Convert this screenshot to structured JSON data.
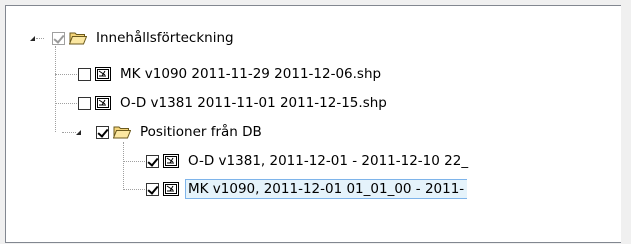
{
  "tree": {
    "root": {
      "label": "Innehållsförteckning",
      "checked": true,
      "enabled": false,
      "expanded": true,
      "icon": "folder-open-icon"
    },
    "root_items": [
      {
        "label": "MK v1090 2011-11-29 2011-12-06.shp",
        "checked": false,
        "icon": "shape-layer-icon"
      },
      {
        "label": "O-D v1381 2011-11-01 2011-12-15.shp",
        "checked": false,
        "icon": "shape-layer-icon"
      }
    ],
    "group": {
      "label": "Positioner från DB",
      "checked": true,
      "expanded": true,
      "icon": "folder-open-icon",
      "items": [
        {
          "label": "O-D v1381, 2011-12-01 - 2011-12-10 22_",
          "checked": true,
          "selected": false,
          "icon": "shape-layer-icon"
        },
        {
          "label": "MK v1090, 2011-12-01 01_01_00 - 2011-",
          "checked": true,
          "selected": true,
          "icon": "shape-layer-icon"
        }
      ]
    }
  },
  "colors": {
    "selection_fill": "#e5f3fb",
    "selection_border": "#7eb4ea",
    "folder": "#f5d57a",
    "tree_lines": "#a0a0a0"
  }
}
